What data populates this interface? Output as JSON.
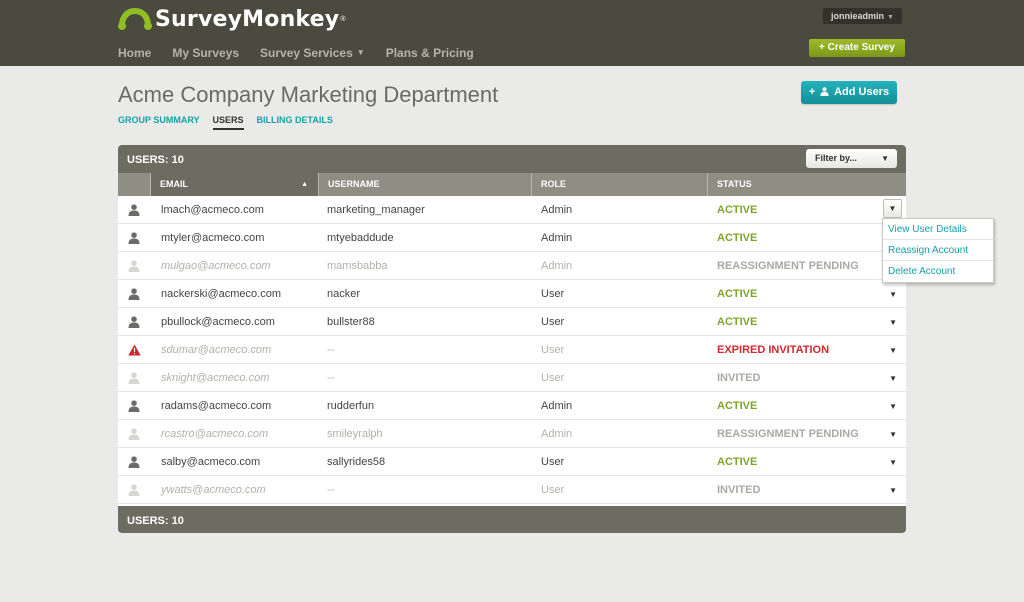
{
  "header": {
    "brand": "SurveyMonkey",
    "brand_mark": "®",
    "nav": [
      {
        "label": "Home",
        "has_caret": false
      },
      {
        "label": "My Surveys",
        "has_caret": false
      },
      {
        "label": "Survey Services",
        "has_caret": true
      },
      {
        "label": "Plans & Pricing",
        "has_caret": false
      }
    ],
    "user_menu": "jonnieadmin",
    "create_survey": "+ Create Survey",
    "accent_green": "#8aa822"
  },
  "page": {
    "title": "Acme Company Marketing Department",
    "tabs": [
      {
        "label": "GROUP SUMMARY",
        "active": false
      },
      {
        "label": "USERS",
        "active": true
      },
      {
        "label": "BILLING DETAILS",
        "active": false
      }
    ],
    "add_users": "Add Users",
    "add_users_prefix": "+",
    "accent_teal": "#17a0a8"
  },
  "table": {
    "count_label": "USERS: 10",
    "filter_label": "Filter by...",
    "columns": [
      "EMAIL",
      "USERNAME",
      "ROLE",
      "STATUS"
    ],
    "sorted_column": "EMAIL",
    "sort_direction": "ascending",
    "rows": [
      {
        "icon": "user-icon",
        "email": "lmach@acmeco.com",
        "username": "marketing_manager",
        "role": "Admin",
        "status": "ACTIVE",
        "status_type": "active",
        "muted": false
      },
      {
        "icon": "user-icon",
        "email": "mtyler@acmeco.com",
        "username": "mtyebaddude",
        "role": "Admin",
        "status": "ACTIVE",
        "status_type": "active",
        "muted": false
      },
      {
        "icon": "user-icon",
        "email": "mulgao@acmeco.com",
        "username": "mamsbabba",
        "role": "Admin",
        "status": "REASSIGNMENT PENDING",
        "status_type": "pending",
        "muted": true
      },
      {
        "icon": "user-icon",
        "email": "nackerski@acmeco.com",
        "username": "nacker",
        "role": "User",
        "status": "ACTIVE",
        "status_type": "active",
        "muted": false
      },
      {
        "icon": "user-icon",
        "email": "pbullock@acmeco.com",
        "username": "bullster88",
        "role": "User",
        "status": "ACTIVE",
        "status_type": "active",
        "muted": false
      },
      {
        "icon": "warning-icon",
        "email": "sdumar@acmeco.com",
        "username": "--",
        "role": "User",
        "status": "EXPIRED INVITATION",
        "status_type": "expired",
        "muted": true
      },
      {
        "icon": "user-icon",
        "email": "sknight@acmeco.com",
        "username": "--",
        "role": "User",
        "status": "INVITED",
        "status_type": "invited",
        "muted": true
      },
      {
        "icon": "user-icon",
        "email": "radams@acmeco.com",
        "username": "rudderfun",
        "role": "Admin",
        "status": "ACTIVE",
        "status_type": "active",
        "muted": false
      },
      {
        "icon": "user-icon",
        "email": "rcastro@acmeco.com",
        "username": "smileyralph",
        "role": "Admin",
        "status": "REASSIGNMENT PENDING",
        "status_type": "pending",
        "muted": true
      },
      {
        "icon": "user-icon",
        "email": "salby@acmeco.com",
        "username": "sallyrides58",
        "role": "User",
        "status": "ACTIVE",
        "status_type": "active",
        "muted": false
      },
      {
        "icon": "user-icon",
        "email": "ywatts@acmeco.com",
        "username": "--",
        "role": "User",
        "status": "INVITED",
        "status_type": "invited",
        "muted": true
      }
    ],
    "footer_count_label": "USERS: 10",
    "status_colors": {
      "active": "#7da52a",
      "pending": "#a9a9a5",
      "expired": "#d0292e",
      "invited": "#a9a9a5"
    }
  },
  "row_menu": {
    "open_row_index": 0,
    "items": [
      "View User Details",
      "Reassign Account",
      "Delete Account"
    ]
  }
}
